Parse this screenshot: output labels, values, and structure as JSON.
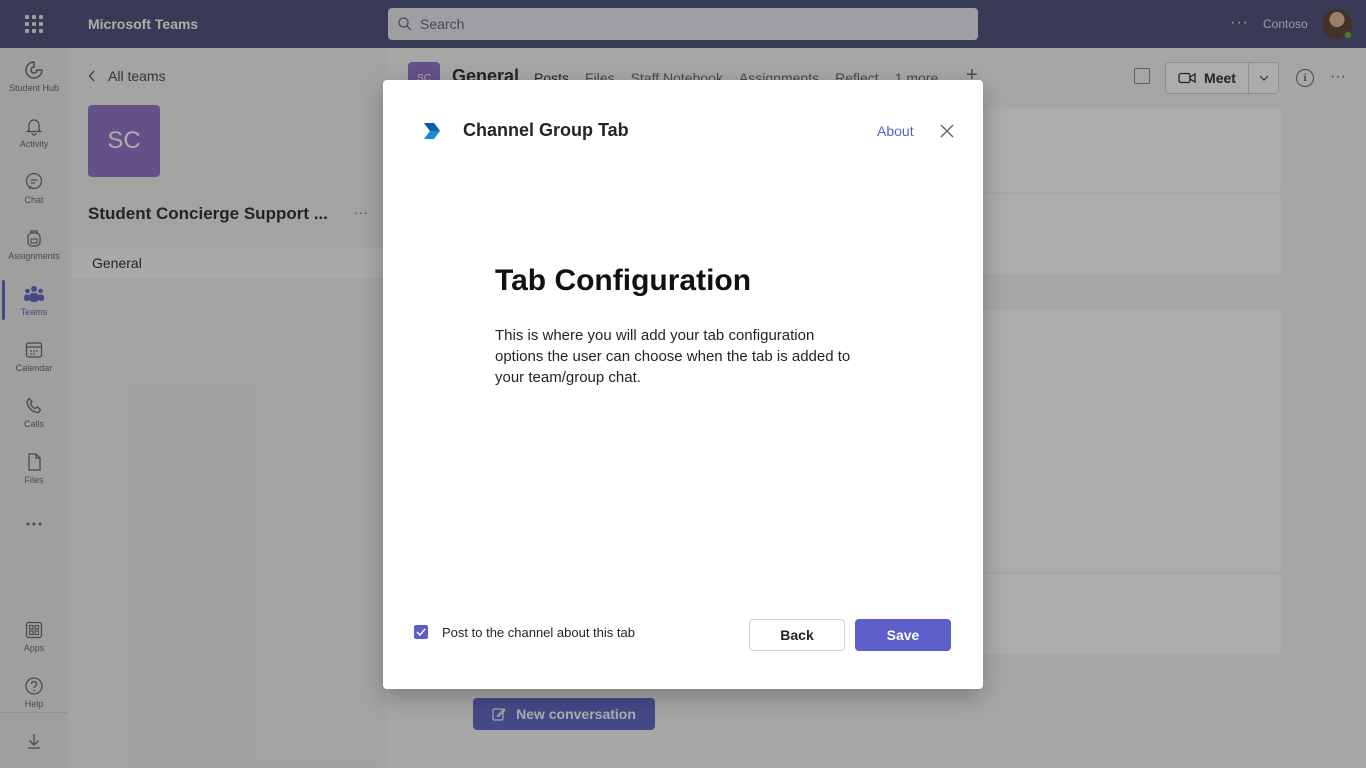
{
  "topbar": {
    "app_title": "Microsoft Teams",
    "search_placeholder": "Search",
    "more": "···",
    "org": "Contoso"
  },
  "rail": {
    "items": [
      {
        "label": "Student Hub",
        "icon": "student-hub-icon"
      },
      {
        "label": "Activity",
        "icon": "bell-icon"
      },
      {
        "label": "Chat",
        "icon": "chat-icon"
      },
      {
        "label": "Assignments",
        "icon": "backpack-icon"
      },
      {
        "label": "Teams",
        "icon": "teams-icon",
        "active": true
      },
      {
        "label": "Calendar",
        "icon": "calendar-icon"
      },
      {
        "label": "Calls",
        "icon": "phone-icon"
      },
      {
        "label": "Files",
        "icon": "file-icon"
      },
      {
        "label": "",
        "icon": "more-icon"
      },
      {
        "label": "Apps",
        "icon": "apps-icon"
      },
      {
        "label": "Help",
        "icon": "help-icon"
      },
      {
        "label": "",
        "icon": "download-icon"
      }
    ]
  },
  "team_panel": {
    "back_label": "All teams",
    "team_initials": "SC",
    "team_name": "Student Concierge Support ...",
    "more": "···",
    "channel": "General"
  },
  "channel_header": {
    "avatar": "SC",
    "title": "General",
    "tabs": [
      "Posts",
      "Files",
      "Staff Notebook",
      "Assignments",
      "Reflect",
      "1 more"
    ],
    "meet_label": "Meet",
    "more": "···"
  },
  "main": {
    "new_conversation_label": "New conversation"
  },
  "dialog": {
    "app_name": "Channel Group Tab",
    "about_label": "About",
    "heading": "Tab Configuration",
    "body": "This is where you will add your tab configuration options the user can choose when the tab is added to your team/group chat.",
    "checkbox_label": "Post to the channel about this tab",
    "checkbox_checked": true,
    "back_label": "Back",
    "save_label": "Save"
  },
  "colors": {
    "topbar": "#464775",
    "accent": "#5b5fc7",
    "team_tile": "#8b6cc8"
  }
}
